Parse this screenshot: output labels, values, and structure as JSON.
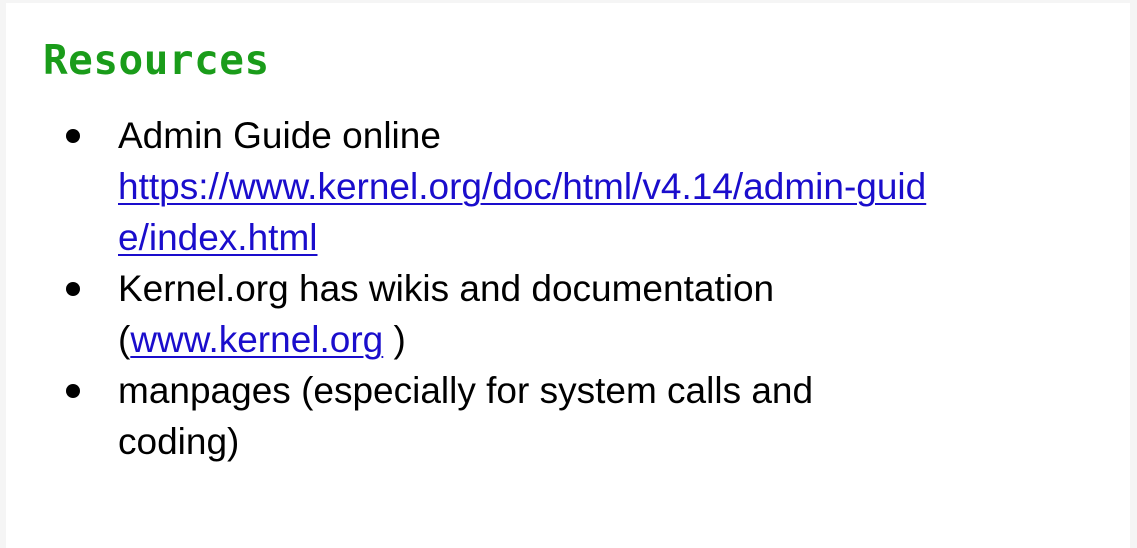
{
  "title": "Resources",
  "colors": {
    "title": "#1a9c1a",
    "link": "#1a0dcc",
    "text": "#000000",
    "background": "#ffffff"
  },
  "bullets": [
    {
      "text": "Admin Guide online",
      "link_line1": "https://www.kernel.org/doc/html/v4.14/admin-guid",
      "link_line2": "e/index.html"
    },
    {
      "text": "Kernel.org has wikis and documentation",
      "paren_open": "(",
      "link": "www.kernel.org",
      "paren_close": " )"
    },
    {
      "line1": "manpages (especially for system calls and",
      "line2": "coding)"
    }
  ]
}
